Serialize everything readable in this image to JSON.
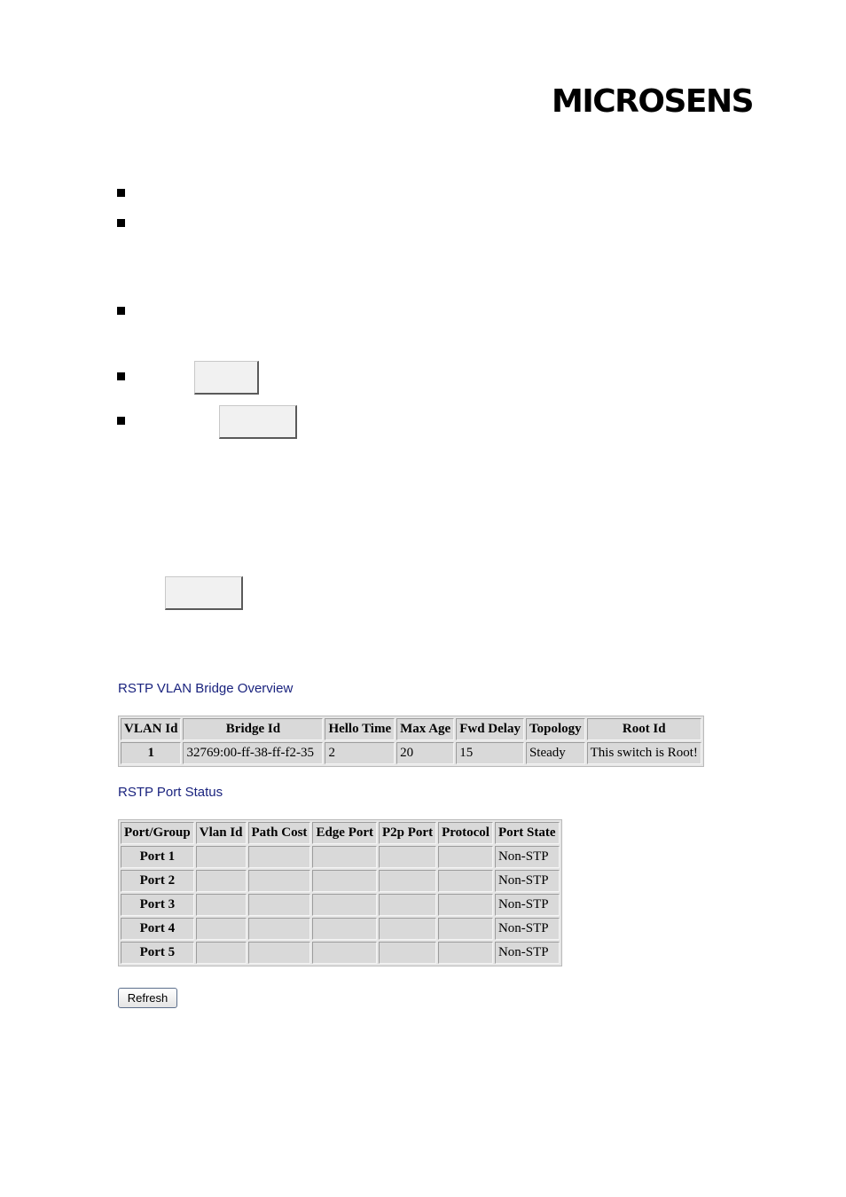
{
  "header": {
    "logo_text": "MICROSENS"
  },
  "bridge_overview": {
    "title": "RSTP VLAN Bridge Overview",
    "columns": [
      "VLAN Id",
      "Bridge Id",
      "Hello Time",
      "Max Age",
      "Fwd Delay",
      "Topology",
      "Root Id"
    ],
    "rows": [
      [
        "1",
        "32769:00-ff-38-ff-f2-35",
        "2",
        "20",
        "15",
        "Steady",
        "This switch is Root!"
      ]
    ]
  },
  "port_status": {
    "title": "RSTP Port Status",
    "columns": [
      "Port/Group",
      "Vlan Id",
      "Path Cost",
      "Edge Port",
      "P2p Port",
      "Protocol",
      "Port State"
    ],
    "rows": [
      [
        "Port 1",
        "",
        "",
        "",
        "",
        "",
        "Non-STP"
      ],
      [
        "Port 2",
        "",
        "",
        "",
        "",
        "",
        "Non-STP"
      ],
      [
        "Port 3",
        "",
        "",
        "",
        "",
        "",
        "Non-STP"
      ],
      [
        "Port 4",
        "",
        "",
        "",
        "",
        "",
        "Non-STP"
      ],
      [
        "Port 5",
        "",
        "",
        "",
        "",
        "",
        "Non-STP"
      ]
    ]
  },
  "actions": {
    "refresh_label": "Refresh"
  }
}
